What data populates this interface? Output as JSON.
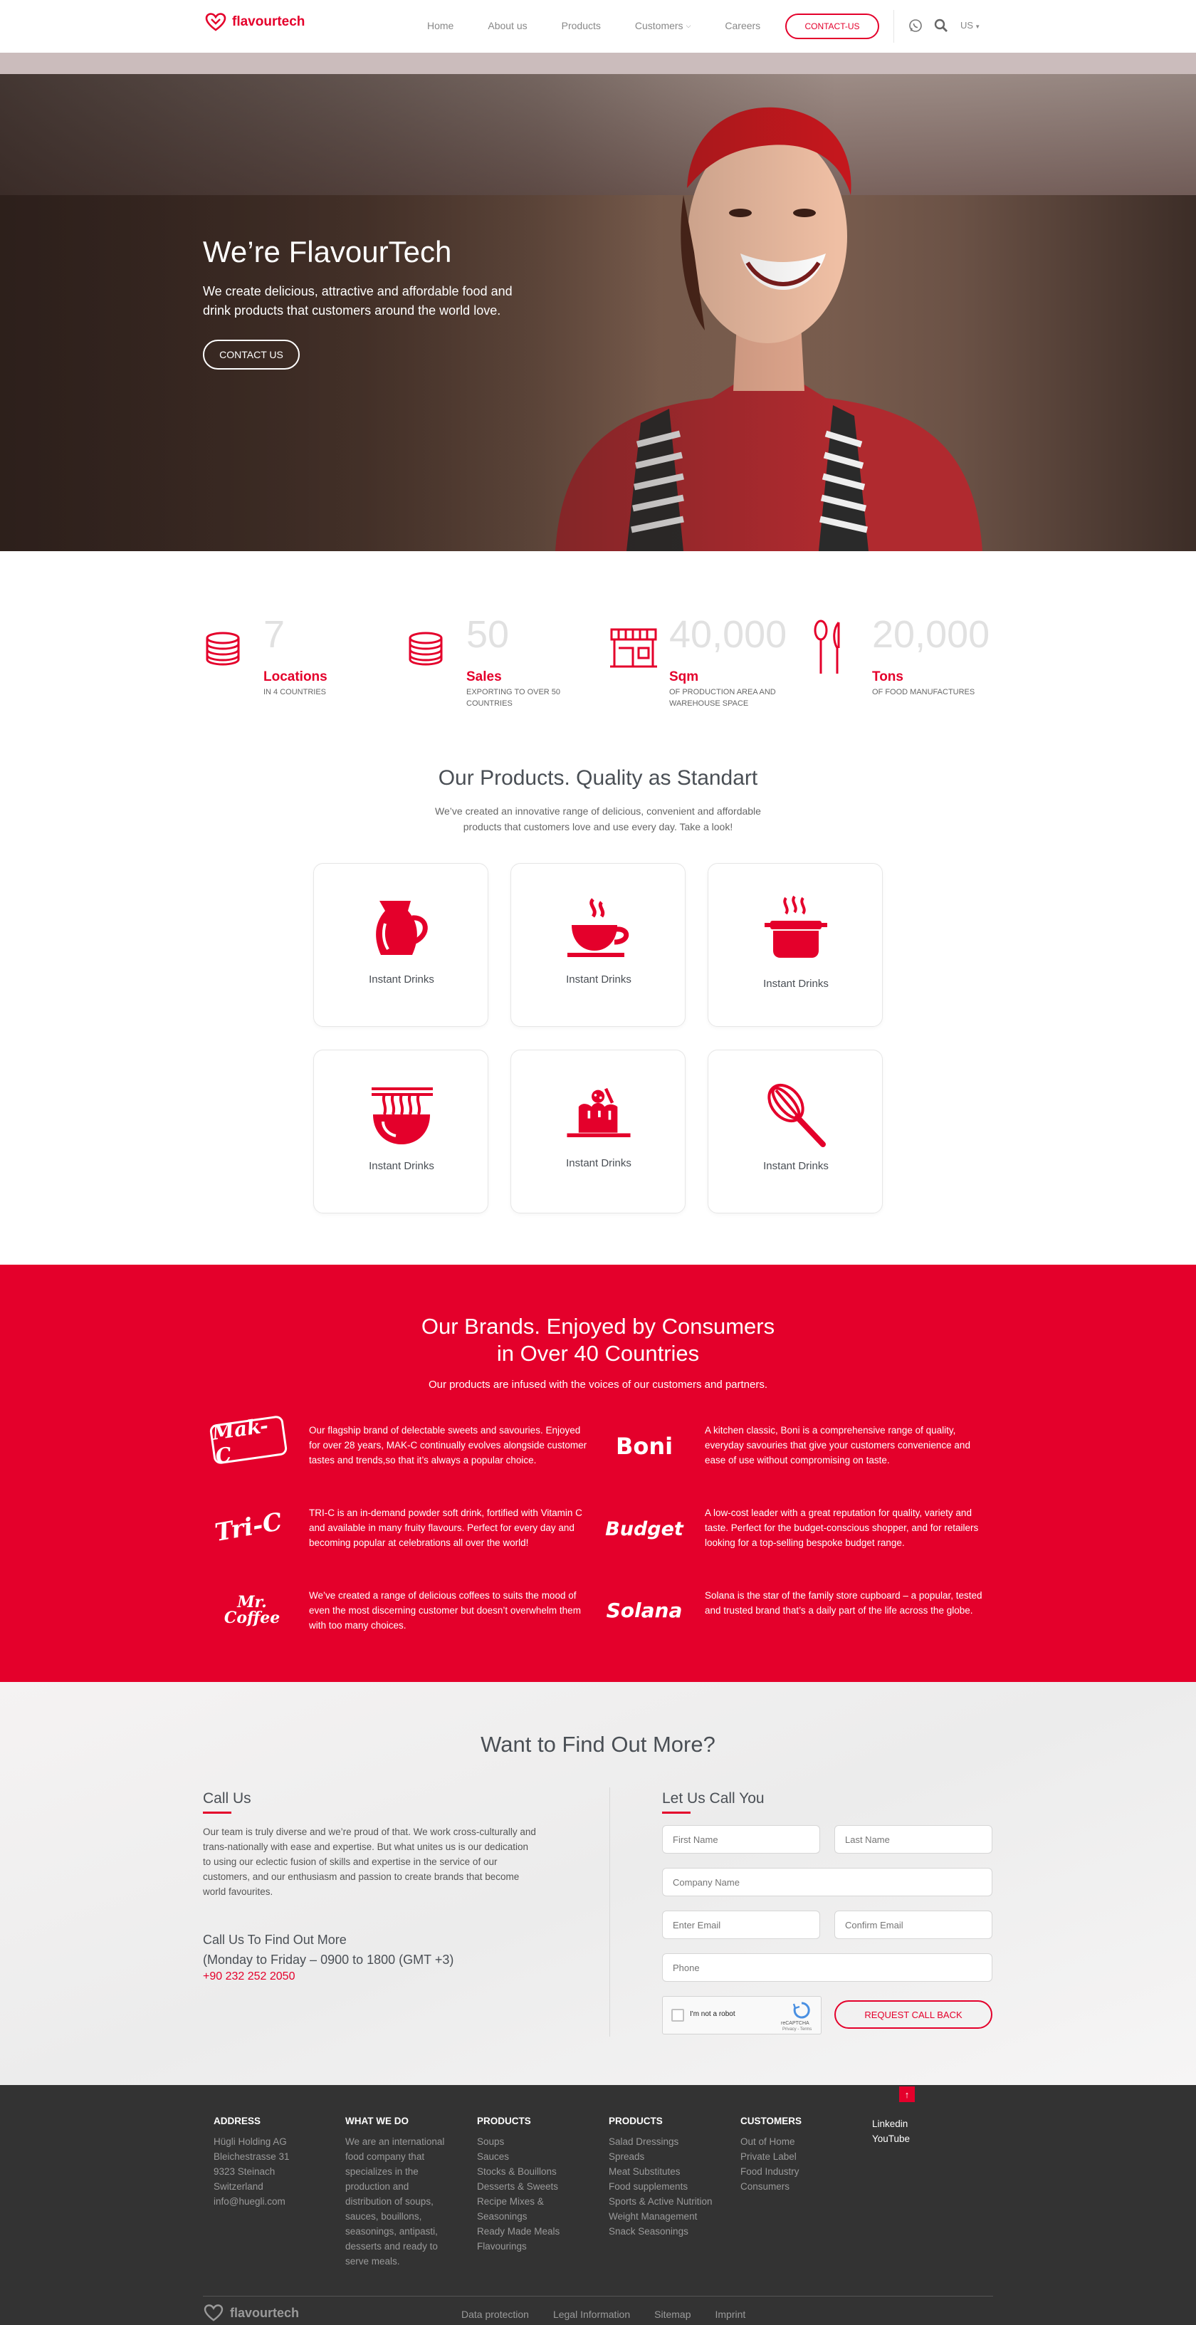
{
  "nav": {
    "logo_text": "flavourtech",
    "links": [
      "Home",
      "About us",
      "Products",
      "Customers",
      "Careers"
    ],
    "contact_button": "CONTACT-US",
    "language": "US"
  },
  "hero": {
    "title": "We’re FlavourTech",
    "subtitle": "We create delicious, attractive and affordable food and drink products that customers around the world love.",
    "button": "CONTACT US"
  },
  "stats": [
    {
      "number": "7",
      "title": "Locations",
      "desc": "IN 4 COUNTRIES",
      "icon": "coins-icon"
    },
    {
      "number": "50",
      "title": "Sales",
      "desc": "EXPORTING TO OVER 50 COUNTRIES",
      "icon": "coins-icon"
    },
    {
      "number": "40,000",
      "title": "Sqm",
      "desc": "OF PRODUCTION AREA AND WAREHOUSE SPACE",
      "icon": "store-icon"
    },
    {
      "number": "20,000",
      "title": "Tons",
      "desc": "OF FOOD MANUFACTURES",
      "icon": "cutlery-icon"
    }
  ],
  "products": {
    "title": "Our Products. Quality as Standart",
    "subtitle": "We’ve created an innovative range of delicious, convenient and affordable products that customers love and use every day. Take a look!",
    "items": [
      {
        "label": "Instant Drinks",
        "icon": "jug-icon"
      },
      {
        "label": "Instant Drinks",
        "icon": "coffee-cup-icon"
      },
      {
        "label": "Instant Drinks",
        "icon": "pot-icon"
      },
      {
        "label": "Instant Drinks",
        "icon": "noodle-bowl-icon"
      },
      {
        "label": "Instant Drinks",
        "icon": "cake-icon"
      },
      {
        "label": "Instant Drinks",
        "icon": "whisk-icon"
      }
    ]
  },
  "brands": {
    "title_line1": "Our Brands. Enjoyed by Consumers",
    "title_line2": "in Over 40 Countries",
    "subtitle": "Our products are infused with the voices of our customers and partners.",
    "items": [
      {
        "name": "Mak-C",
        "text": "Our flagship brand of delectable sweets and savouries. Enjoyed for over 28 years, MAK-C continually evolves alongside customer tastes and trends,so that it’s always a popular choice."
      },
      {
        "name": "Boni",
        "text": "A kitchen classic, Boni is a comprehensive range of quality, everyday savouries that give your customers convenience and ease of use without compromising on taste."
      },
      {
        "name": "Tri-C",
        "text": "TRI-C is an in-demand powder soft drink, fortified with Vitamin C and available in many fruity flavours. Perfect for every day and becoming popular at celebrations all over the world!"
      },
      {
        "name": "Budget",
        "text": "A low-cost leader with a great reputation for quality, variety and taste. Perfect for the budget-conscious shopper, and for retailers looking for a top-selling bespoke budget range."
      },
      {
        "name": "Mr. Coffee",
        "text": "We’ve created a range of delicious coffees to suits the mood of even the most discerning customer but doesn’t overwhelm them with too many choices."
      },
      {
        "name": "Solana",
        "text": "Solana is the star of the family store cupboard – a popular, tested and trusted brand that’s a daily part of the life across the globe."
      }
    ]
  },
  "contact": {
    "title": "Want to Find Out More?",
    "call_us_title": "Call Us",
    "call_us_body": "Our team is truly diverse and we’re proud of that. We work cross-culturally and trans-nationally with ease and expertise. But what unites us is our dedication to using our eclectic fusion of skills and expertise in the service of our customers, and our enthusiasm and passion to create brands that become world favourites.",
    "call_info_line1": "Call Us To Find Out More",
    "call_info_line2": "(Monday to Friday – 0900 to 1800 (GMT +3)",
    "phone": "+90 232 252 2050",
    "form_title": "Let Us Call You",
    "placeholders": {
      "first_name": "First Name",
      "last_name": "Last Name",
      "company": "Company Name",
      "email": "Enter Email",
      "confirm_email": "Confirm Email",
      "phone": "Phone"
    },
    "captcha_label": "I'm not a robot",
    "captcha_brand": "reCAPTCHA",
    "captcha_terms": "Privacy - Terms",
    "submit": "REQUEST CALL BACK"
  },
  "footer": {
    "address": {
      "title": "ADDRESS",
      "lines": [
        "Hügli Holding AG",
        "Bleichestrasse 31",
        "9323 Steinach",
        "Switzerland",
        "info@huegli.com"
      ]
    },
    "what_we_do": {
      "title": "WHAT WE DO",
      "text": "We are an international food company that specializes in the production and distribution of soups, sauces, bouillons, seasonings, antipasti, desserts and ready to serve meals."
    },
    "products1": {
      "title": "PRODUCTS",
      "items": [
        "Soups",
        "Sauces",
        "Stocks & Bouillons",
        "Desserts & Sweets",
        "Recipe Mixes & Seasonings",
        "Ready Made Meals",
        "Flavourings"
      ]
    },
    "products2": {
      "title": "PRODUCTS",
      "items": [
        "Salad Dressings",
        "Spreads",
        "Meat Substitutes",
        "Food supplements",
        "Sports & Active Nutrition",
        "Weight Management",
        "Snack Seasonings"
      ]
    },
    "customers": {
      "title": "CUSTOMERS",
      "items": [
        "Out of Home",
        "Private Label",
        "Food Industry",
        "Consumers"
      ]
    },
    "social": [
      "Linkedin",
      "YouTube"
    ],
    "logo_text": "flavourtech",
    "bottom_links": [
      "Data protection",
      "Legal Information",
      "Sitemap",
      "Imprint"
    ]
  },
  "colors": {
    "brand_red": "#e4002b",
    "footer_bg": "#333333"
  }
}
